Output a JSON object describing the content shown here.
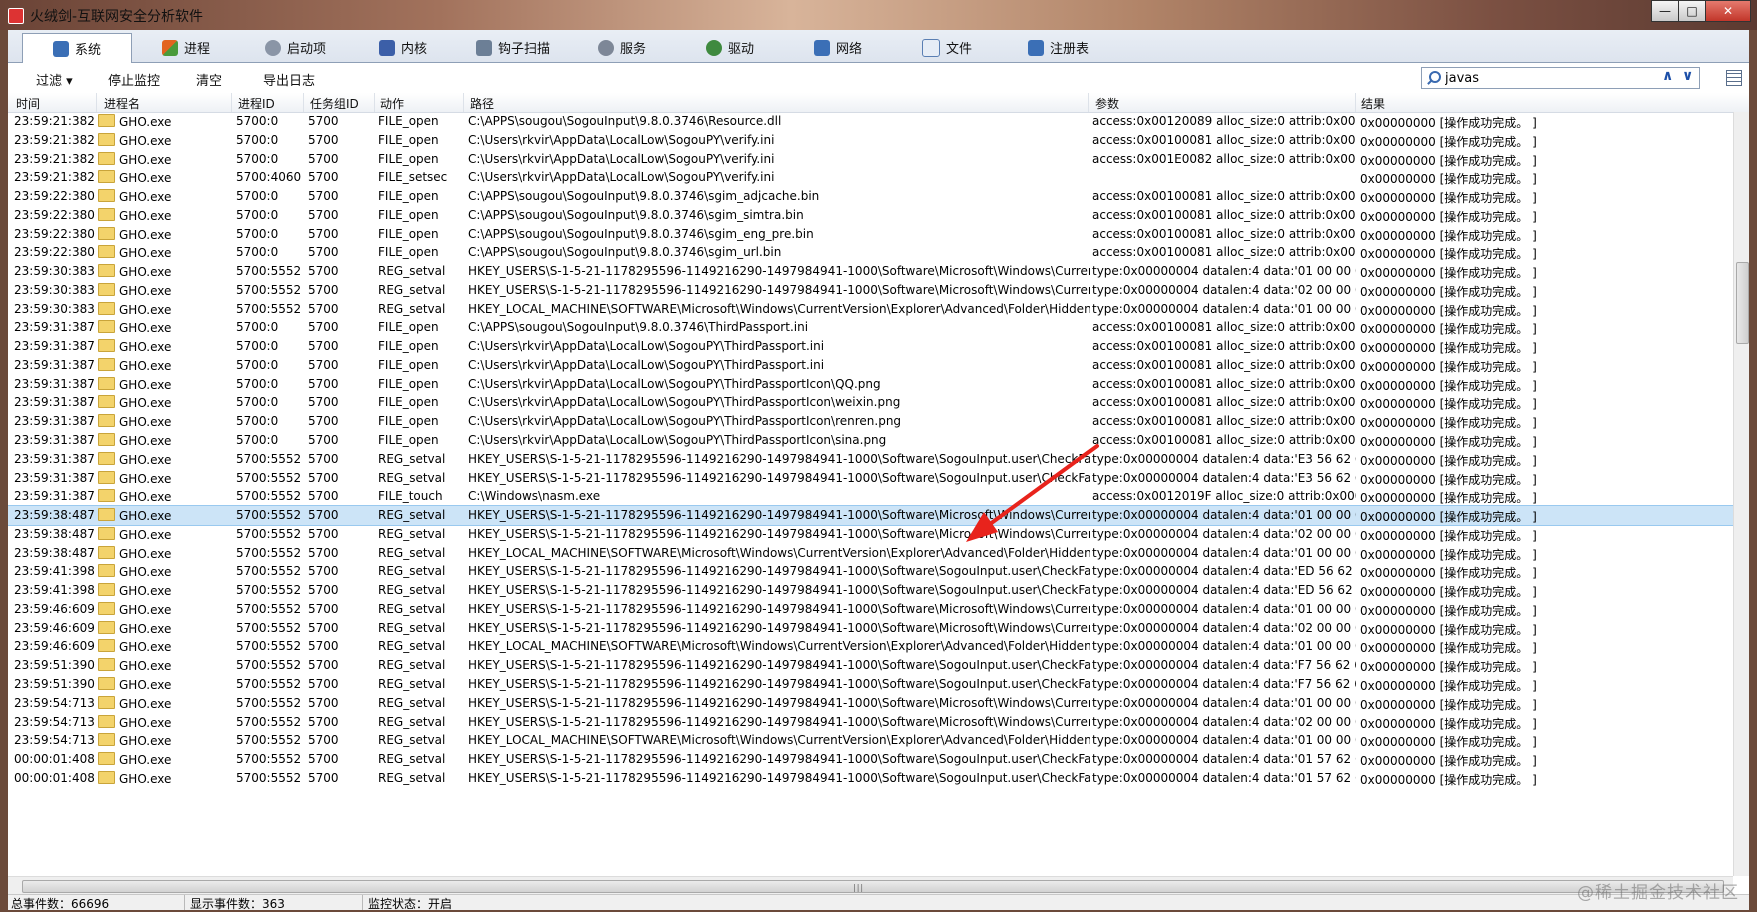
{
  "window": {
    "title": "火绒剑-互联网安全分析软件",
    "min_label": "—",
    "max_label": "□",
    "close_label": "✕"
  },
  "tabs": [
    {
      "label": "系统",
      "icon": "monitor-icon",
      "color": "#3b6fb6"
    },
    {
      "label": "进程",
      "icon": "windows-icon",
      "color": "#e2641f"
    },
    {
      "label": "启动项",
      "icon": "gear-icon",
      "color": "#6b7a8f"
    },
    {
      "label": "内核",
      "icon": "kernel-icon",
      "color": "#3c5fa8"
    },
    {
      "label": "钩子扫描",
      "icon": "hook-icon",
      "color": "#6c7f96"
    },
    {
      "label": "服务",
      "icon": "service-icon",
      "color": "#6b7a8f"
    },
    {
      "label": "驱动",
      "icon": "driver-icon",
      "color": "#3f8a3f"
    },
    {
      "label": "网络",
      "icon": "network-icon",
      "color": "#3b6fb6"
    },
    {
      "label": "文件",
      "icon": "file-icon",
      "color": "#5a7fb3"
    },
    {
      "label": "注册表",
      "icon": "registry-icon",
      "color": "#3b6fb6"
    }
  ],
  "toolbar": {
    "filter_label": "过滤 ▾",
    "stop_label": "停止监控",
    "clear_label": "清空",
    "export_label": "导出日志",
    "search_value": "javas",
    "up_arrow": "∧",
    "down_arrow": "∨"
  },
  "columns": [
    "时间",
    "进程名",
    "进程ID",
    "任务组ID",
    "动作",
    "路径",
    "参数",
    "结果"
  ],
  "rows": [
    [
      "23:59:21:382",
      "GHO.exe",
      "5700:0",
      "5700",
      "FILE_open",
      "C:\\APPS\\sougou\\SogouInput\\9.8.0.3746\\Resource.dll",
      "access:0x00120089 alloc_size:0 attrib:0x00000000...",
      "0x00000000 [操作成功完成。 ]"
    ],
    [
      "23:59:21:382",
      "GHO.exe",
      "5700:0",
      "5700",
      "FILE_open",
      "C:\\Users\\rkvir\\AppData\\LocalLow\\SogouPY\\verify.ini",
      "access:0x00100081 alloc_size:0 attrib:0x00000000...",
      "0x00000000 [操作成功完成。 ]"
    ],
    [
      "23:59:21:382",
      "GHO.exe",
      "5700:0",
      "5700",
      "FILE_open",
      "C:\\Users\\rkvir\\AppData\\LocalLow\\SogouPY\\verify.ini",
      "access:0x001E0082 alloc_size:0 attrib:0x00000000...",
      "0x00000000 [操作成功完成。 ]"
    ],
    [
      "23:59:21:382",
      "GHO.exe",
      "5700:4060",
      "5700",
      "FILE_setsec",
      "C:\\Users\\rkvir\\AppData\\LocalLow\\SogouPY\\verify.ini",
      "",
      "0x00000000 [操作成功完成。 ]"
    ],
    [
      "23:59:22:380",
      "GHO.exe",
      "5700:0",
      "5700",
      "FILE_open",
      "C:\\APPS\\sougou\\SogouInput\\9.8.0.3746\\sgim_adjcache.bin",
      "access:0x00100081 alloc_size:0 attrib:0x00000000...",
      "0x00000000 [操作成功完成。 ]"
    ],
    [
      "23:59:22:380",
      "GHO.exe",
      "5700:0",
      "5700",
      "FILE_open",
      "C:\\APPS\\sougou\\SogouInput\\9.8.0.3746\\sgim_simtra.bin",
      "access:0x00100081 alloc_size:0 attrib:0x00000000...",
      "0x00000000 [操作成功完成。 ]"
    ],
    [
      "23:59:22:380",
      "GHO.exe",
      "5700:0",
      "5700",
      "FILE_open",
      "C:\\APPS\\sougou\\SogouInput\\9.8.0.3746\\sgim_eng_pre.bin",
      "access:0x00100081 alloc_size:0 attrib:0x00000000...",
      "0x00000000 [操作成功完成。 ]"
    ],
    [
      "23:59:22:380",
      "GHO.exe",
      "5700:0",
      "5700",
      "FILE_open",
      "C:\\APPS\\sougou\\SogouInput\\9.8.0.3746\\sgim_url.bin",
      "access:0x00100081 alloc_size:0 attrib:0x00000000...",
      "0x00000000 [操作成功完成。 ]"
    ],
    [
      "23:59:30:383",
      "GHO.exe",
      "5700:5552",
      "5700",
      "REG_setval",
      "HKEY_USERS\\S-1-5-21-1178295596-1149216290-1497984941-1000\\Software\\Microsoft\\Windows\\CurrentVersion\\Expl...",
      "type:0x00000004 datalen:4 data:'01 00 00 00 '",
      "0x00000000 [操作成功完成。 ]"
    ],
    [
      "23:59:30:383",
      "GHO.exe",
      "5700:5552",
      "5700",
      "REG_setval",
      "HKEY_USERS\\S-1-5-21-1178295596-1149216290-1497984941-1000\\Software\\Microsoft\\Windows\\CurrentVersion\\Expl...",
      "type:0x00000004 datalen:4 data:'02 00 00 00 '",
      "0x00000000 [操作成功完成。 ]"
    ],
    [
      "23:59:30:383",
      "GHO.exe",
      "5700:5552",
      "5700",
      "REG_setval",
      "HKEY_LOCAL_MACHINE\\SOFTWARE\\Microsoft\\Windows\\CurrentVersion\\Explorer\\Advanced\\Folder\\Hidden\\SHOWALL...",
      "type:0x00000004 datalen:4 data:'01 00 00 00 '",
      "0x00000000 [操作成功完成。 ]"
    ],
    [
      "23:59:31:387",
      "GHO.exe",
      "5700:0",
      "5700",
      "FILE_open",
      "C:\\APPS\\sougou\\SogouInput\\9.8.0.3746\\ThirdPassport.ini",
      "access:0x00100081 alloc_size:0 attrib:0x00000000...",
      "0x00000000 [操作成功完成。 ]"
    ],
    [
      "23:59:31:387",
      "GHO.exe",
      "5700:0",
      "5700",
      "FILE_open",
      "C:\\Users\\rkvir\\AppData\\LocalLow\\SogouPY\\ThirdPassport.ini",
      "access:0x00100081 alloc_size:0 attrib:0x00000000...",
      "0x00000000 [操作成功完成。 ]"
    ],
    [
      "23:59:31:387",
      "GHO.exe",
      "5700:0",
      "5700",
      "FILE_open",
      "C:\\Users\\rkvir\\AppData\\LocalLow\\SogouPY\\ThirdPassport.ini",
      "access:0x00100081 alloc_size:0 attrib:0x00000000...",
      "0x00000000 [操作成功完成。 ]"
    ],
    [
      "23:59:31:387",
      "GHO.exe",
      "5700:0",
      "5700",
      "FILE_open",
      "C:\\Users\\rkvir\\AppData\\LocalLow\\SogouPY\\ThirdPassportIcon\\QQ.png",
      "access:0x00100081 alloc_size:0 attrib:0x00000000...",
      "0x00000000 [操作成功完成。 ]"
    ],
    [
      "23:59:31:387",
      "GHO.exe",
      "5700:0",
      "5700",
      "FILE_open",
      "C:\\Users\\rkvir\\AppData\\LocalLow\\SogouPY\\ThirdPassportIcon\\weixin.png",
      "access:0x00100081 alloc_size:0 attrib:0x00000000...",
      "0x00000000 [操作成功完成。 ]"
    ],
    [
      "23:59:31:387",
      "GHO.exe",
      "5700:0",
      "5700",
      "FILE_open",
      "C:\\Users\\rkvir\\AppData\\LocalLow\\SogouPY\\ThirdPassportIcon\\renren.png",
      "access:0x00100081 alloc_size:0 attrib:0x00000000...",
      "0x00000000 [操作成功完成。 ]"
    ],
    [
      "23:59:31:387",
      "GHO.exe",
      "5700:0",
      "5700",
      "FILE_open",
      "C:\\Users\\rkvir\\AppData\\LocalLow\\SogouPY\\ThirdPassportIcon\\sina.png",
      "access:0x00100081 alloc_size:0 attrib:0x00000000...",
      "0x00000000 [操作成功完成。 ]"
    ],
    [
      "23:59:31:387",
      "GHO.exe",
      "5700:5552",
      "5700",
      "REG_setval",
      "HKEY_USERS\\S-1-5-21-1178295596-1149216290-1497984941-1000\\Software\\SogouInput.user\\CheckFastpassport",
      "type:0x00000004 datalen:4 data:'E3 56 62 64 '",
      "0x00000000 [操作成功完成。 ]"
    ],
    [
      "23:59:31:387",
      "GHO.exe",
      "5700:5552",
      "5700",
      "REG_setval",
      "HKEY_USERS\\S-1-5-21-1178295596-1149216290-1497984941-1000\\Software\\SogouInput.user\\CheckFastpassport",
      "type:0x00000004 datalen:4 data:'E3 56 62 64 '",
      "0x00000000 [操作成功完成。 ]"
    ],
    [
      "23:59:31:387",
      "GHO.exe",
      "5700:5552",
      "5700",
      "FILE_touch",
      "C:\\Windows\\nasm.exe",
      "access:0x0012019F alloc_size:0 attrib:0x0000080...",
      "0x00000000 [操作成功完成。 ]"
    ],
    [
      "23:59:38:487",
      "GHO.exe",
      "5700:5552",
      "5700",
      "REG_setval",
      "HKEY_USERS\\S-1-5-21-1178295596-1149216290-1497984941-1000\\Software\\Microsoft\\Windows\\CurrentVersion\\Expl...",
      "type:0x00000004 datalen:4 data:'01 00 00 00 '",
      "0x00000000 [操作成功完成。 ]"
    ],
    [
      "23:59:38:487",
      "GHO.exe",
      "5700:5552",
      "5700",
      "REG_setval",
      "HKEY_USERS\\S-1-5-21-1178295596-1149216290-1497984941-1000\\Software\\Microsoft\\Windows\\CurrentVersion\\Expl...",
      "type:0x00000004 datalen:4 data:'02 00 00 00 '",
      "0x00000000 [操作成功完成。 ]"
    ],
    [
      "23:59:38:487",
      "GHO.exe",
      "5700:5552",
      "5700",
      "REG_setval",
      "HKEY_LOCAL_MACHINE\\SOFTWARE\\Microsoft\\Windows\\CurrentVersion\\Explorer\\Advanced\\Folder\\Hidden\\SHOWALL...",
      "type:0x00000004 datalen:4 data:'01 00 00 00 '",
      "0x00000000 [操作成功完成。 ]"
    ],
    [
      "23:59:41:398",
      "GHO.exe",
      "5700:5552",
      "5700",
      "REG_setval",
      "HKEY_USERS\\S-1-5-21-1178295596-1149216290-1497984941-1000\\Software\\SogouInput.user\\CheckFastpassport",
      "type:0x00000004 datalen:4 data:'ED 56 62 64 '",
      "0x00000000 [操作成功完成。 ]"
    ],
    [
      "23:59:41:398",
      "GHO.exe",
      "5700:5552",
      "5700",
      "REG_setval",
      "HKEY_USERS\\S-1-5-21-1178295596-1149216290-1497984941-1000\\Software\\SogouInput.user\\CheckFastpassport",
      "type:0x00000004 datalen:4 data:'ED 56 62 64 '",
      "0x00000000 [操作成功完成。 ]"
    ],
    [
      "23:59:46:609",
      "GHO.exe",
      "5700:5552",
      "5700",
      "REG_setval",
      "HKEY_USERS\\S-1-5-21-1178295596-1149216290-1497984941-1000\\Software\\Microsoft\\Windows\\CurrentVersion\\Expl...",
      "type:0x00000004 datalen:4 data:'01 00 00 00 '",
      "0x00000000 [操作成功完成。 ]"
    ],
    [
      "23:59:46:609",
      "GHO.exe",
      "5700:5552",
      "5700",
      "REG_setval",
      "HKEY_USERS\\S-1-5-21-1178295596-1149216290-1497984941-1000\\Software\\Microsoft\\Windows\\CurrentVersion\\Expl...",
      "type:0x00000004 datalen:4 data:'02 00 00 00 '",
      "0x00000000 [操作成功完成。 ]"
    ],
    [
      "23:59:46:609",
      "GHO.exe",
      "5700:5552",
      "5700",
      "REG_setval",
      "HKEY_LOCAL_MACHINE\\SOFTWARE\\Microsoft\\Windows\\CurrentVersion\\Explorer\\Advanced\\Folder\\Hidden\\SHOWALL...",
      "type:0x00000004 datalen:4 data:'01 00 00 00 '",
      "0x00000000 [操作成功完成。 ]"
    ],
    [
      "23:59:51:390",
      "GHO.exe",
      "5700:5552",
      "5700",
      "REG_setval",
      "HKEY_USERS\\S-1-5-21-1178295596-1149216290-1497984941-1000\\Software\\SogouInput.user\\CheckFastpassport",
      "type:0x00000004 datalen:4 data:'F7 56 62 64 '",
      "0x00000000 [操作成功完成。 ]"
    ],
    [
      "23:59:51:390",
      "GHO.exe",
      "5700:5552",
      "5700",
      "REG_setval",
      "HKEY_USERS\\S-1-5-21-1178295596-1149216290-1497984941-1000\\Software\\SogouInput.user\\CheckFastpassport",
      "type:0x00000004 datalen:4 data:'F7 56 62 64 '",
      "0x00000000 [操作成功完成。 ]"
    ],
    [
      "23:59:54:713",
      "GHO.exe",
      "5700:5552",
      "5700",
      "REG_setval",
      "HKEY_USERS\\S-1-5-21-1178295596-1149216290-1497984941-1000\\Software\\Microsoft\\Windows\\CurrentVersion\\Expl...",
      "type:0x00000004 datalen:4 data:'01 00 00 00 '",
      "0x00000000 [操作成功完成。 ]"
    ],
    [
      "23:59:54:713",
      "GHO.exe",
      "5700:5552",
      "5700",
      "REG_setval",
      "HKEY_USERS\\S-1-5-21-1178295596-1149216290-1497984941-1000\\Software\\Microsoft\\Windows\\CurrentVersion\\Expl...",
      "type:0x00000004 datalen:4 data:'02 00 00 00 '",
      "0x00000000 [操作成功完成。 ]"
    ],
    [
      "23:59:54:713",
      "GHO.exe",
      "5700:5552",
      "5700",
      "REG_setval",
      "HKEY_LOCAL_MACHINE\\SOFTWARE\\Microsoft\\Windows\\CurrentVersion\\Explorer\\Advanced\\Folder\\Hidden\\SHOWALL...",
      "type:0x00000004 datalen:4 data:'01 00 00 00 '",
      "0x00000000 [操作成功完成。 ]"
    ],
    [
      "00:00:01:408",
      "GHO.exe",
      "5700:5552",
      "5700",
      "REG_setval",
      "HKEY_USERS\\S-1-5-21-1178295596-1149216290-1497984941-1000\\Software\\SogouInput.user\\CheckFastpassport",
      "type:0x00000004 datalen:4 data:'01 57 62 64 '",
      "0x00000000 [操作成功完成。 ]"
    ],
    [
      "00:00:01:408",
      "GHO.exe",
      "5700:5552",
      "5700",
      "REG_setval",
      "HKEY_USERS\\S-1-5-21-1178295596-1149216290-1497984941-1000\\Software\\SogouInput.user\\CheckFastpassport",
      "type:0x00000004 datalen:4 data:'01 57 62 64 '",
      "0x00000000 [操作成功完成。 ]"
    ]
  ],
  "selected_row": 21,
  "statusbar": {
    "total": "总事件数：66696",
    "shown": "显示事件数：363",
    "monitor": "监控状态：开启"
  },
  "watermark": "@稀土掘金技术社区",
  "colors": {
    "selected_row": "#cce4f7",
    "annotation_arrow": "#e8231c"
  }
}
